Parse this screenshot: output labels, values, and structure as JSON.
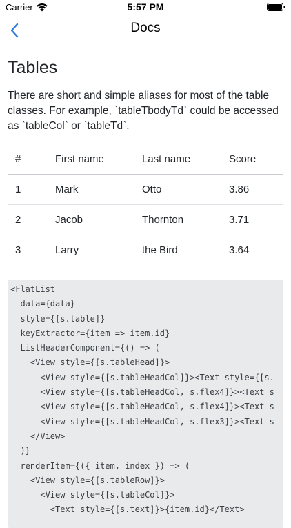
{
  "status_bar": {
    "carrier": "Carrier",
    "time": "5:57 PM"
  },
  "nav": {
    "title": "Docs"
  },
  "content": {
    "heading": "Tables",
    "intro": "There are short and simple aliases for most of the table classes. For example, `tableTbodyTd` could be accessed as `tableCol` or `tableTd`.",
    "table": {
      "headers": [
        "#",
        "First name",
        "Last name",
        "Score"
      ],
      "rows": [
        [
          "1",
          "Mark",
          "Otto",
          "3.86"
        ],
        [
          "2",
          "Jacob",
          "Thornton",
          "3.71"
        ],
        [
          "3",
          "Larry",
          "the Bird",
          "3.64"
        ]
      ]
    },
    "code_lines": [
      "<FlatList",
      "  data={data}",
      "  style={[s.table]}",
      "  keyExtractor={item => item.id}",
      "  ListHeaderComponent={() => (",
      "    <View style={[s.tableHead]}>",
      "      <View style={[s.tableHeadCol]}><Text style={[s.",
      "      <View style={[s.tableHeadCol, s.flex4]}><Text s",
      "      <View style={[s.tableHeadCol, s.flex4]}><Text s",
      "      <View style={[s.tableHeadCol, s.flex3]}><Text s",
      "    </View>",
      "  )}",
      "  renderItem={({ item, index }) => (",
      "    <View style={[s.tableRow]}>",
      "      <View style={[s.tableCol]}>",
      "        <Text style={[s.text]}>{item.id}</Text>"
    ]
  },
  "icons": {
    "back": "chevron-left-icon",
    "wifi": "wifi-icon",
    "battery": "battery-icon"
  },
  "colors": {
    "accent": "#2f7bd8",
    "code_bg": "#e8eaec"
  }
}
